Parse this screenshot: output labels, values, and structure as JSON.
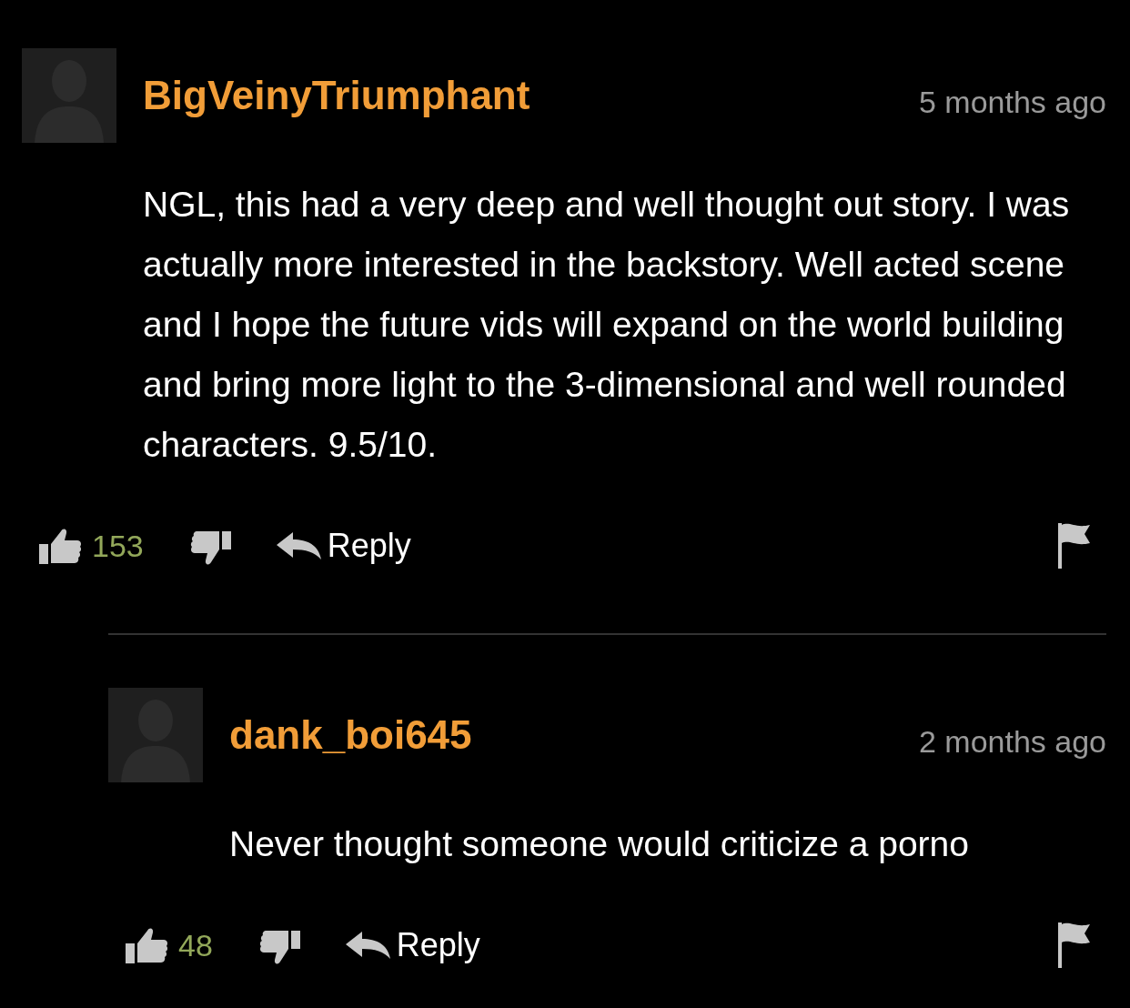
{
  "comments": [
    {
      "author": "BigVeinyTriumphant",
      "time": "5 months ago",
      "body": "NGL, this had a very deep and well thought out story. I was actually more interested in the backstory. Well acted scene and I hope the future vids will expand on the world building and bring more light to the 3-dimensional and well rounded characters. 9.5/10.",
      "likes": "153",
      "reply_label": "Reply",
      "children": [
        {
          "author": "dank_boi645",
          "time": "2 months ago",
          "body": "Never thought someone would criticize a porno",
          "likes": "48",
          "reply_label": "Reply"
        }
      ]
    }
  ]
}
